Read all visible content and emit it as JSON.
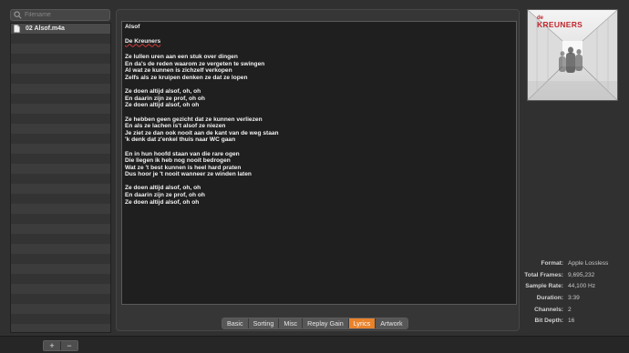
{
  "sidebar": {
    "search_placeholder": "Filename",
    "files": [
      {
        "name": "02 Alsof.m4a"
      }
    ]
  },
  "lyrics": {
    "title": "Alsof",
    "artist": "De Kreuners",
    "body": "\nZe lullen uren aan een stuk over dingen\nEn da's de reden waarom ze vergeten te swingen\nAl wat ze kunnen is zichzelf verkopen\nZelfs als ze kruipen denken ze dat ze lopen\n\nZe doen altijd alsof, oh, oh\nEn daarin zijn ze prof, oh oh\nZe doen altijd alsof, oh oh\n\nZe hebben geen gezicht dat ze kunnen verliezen\nEn als ze lachen is't alsof ze niezen\nJe ziet ze dan ook nooit aan de kant van de weg staan\n'k denk dat z'enkel thuis naar WC gaan\n\nEn in hun hoofd staan van die rare ogen\nDie liegen ik heb nog nooit bedrogen\nWat ze 't best kunnen is heel hard praten\nDus hoor je 't nooit wanneer ze winden laten\n\nZe doen altijd alsof, oh, oh\nEn daarin zijn ze prof, oh oh\nZe doen altijd alsof, oh oh"
  },
  "tabs": [
    {
      "label": "Basic",
      "active": false
    },
    {
      "label": "Sorting",
      "active": false
    },
    {
      "label": "Misc",
      "active": false
    },
    {
      "label": "Replay Gain",
      "active": false
    },
    {
      "label": "Lyrics",
      "active": true
    },
    {
      "label": "Artwork",
      "active": false
    }
  ],
  "artwork": {
    "band_line1": "de",
    "band_line2": "KREUNERS"
  },
  "info": {
    "format_label": "Format:",
    "format_value": "Apple Lossless",
    "frames_label": "Total Frames:",
    "frames_value": "9,695,232",
    "rate_label": "Sample Rate:",
    "rate_value": "44,100 Hz",
    "duration_label": "Duration:",
    "duration_value": "3:39",
    "channels_label": "Channels:",
    "channels_value": "2",
    "depth_label": "Bit Depth:",
    "depth_value": "16"
  },
  "bottom": {
    "add_label": "+",
    "remove_label": "−"
  },
  "colors": {
    "accent": "#e8832c",
    "artwork_red": "#c0272d"
  }
}
